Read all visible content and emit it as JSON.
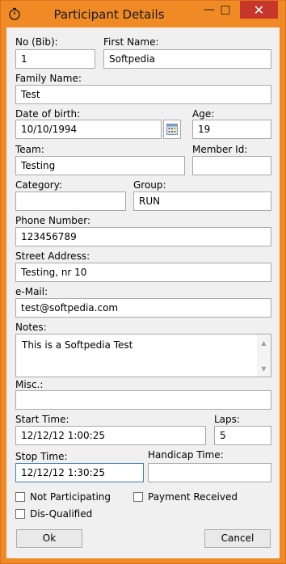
{
  "window": {
    "title": "Participant Details",
    "controls": {
      "minimize": "—",
      "maximize": "□",
      "close": "✕"
    },
    "accent_color": "#f08a24",
    "close_color": "#c7362a",
    "icon": "stopwatch-icon"
  },
  "fields": {
    "bib": {
      "label": "No (Bib):",
      "value": "1"
    },
    "first_name": {
      "label": "First Name:",
      "value": "Softpedia"
    },
    "family_name": {
      "label": "Family Name:",
      "value": "Test"
    },
    "date_of_birth": {
      "label": "Date of birth:",
      "value": "10/10/1994",
      "calendar_icon": "calendar-icon"
    },
    "age": {
      "label": "Age:",
      "value": "19"
    },
    "team": {
      "label": "Team:",
      "value": "Testing"
    },
    "member_id": {
      "label": "Member Id:",
      "value": ""
    },
    "category": {
      "label": "Category:",
      "value": ""
    },
    "group": {
      "label": "Group:",
      "value": "RUN"
    },
    "phone": {
      "label": "Phone Number:",
      "value": "123456789"
    },
    "street": {
      "label": "Street Address:",
      "value": "Testing, nr 10"
    },
    "email": {
      "label": "e-Mail:",
      "value": "test@softpedia.com"
    },
    "notes": {
      "label": "Notes:",
      "value": "This is a Softpedia Test"
    },
    "misc": {
      "label": "Misc.:",
      "value": ""
    },
    "start_time": {
      "label": "Start Time:",
      "value": "12/12/12 1:00:25"
    },
    "laps": {
      "label": "Laps:",
      "value": "5"
    },
    "stop_time": {
      "label": "Stop Time:",
      "value": "12/12/12 1:30:25"
    },
    "handicap_time": {
      "label": "Handicap Time:",
      "value": ""
    }
  },
  "checkboxes": {
    "not_participating": {
      "label": "Not Participating",
      "checked": false
    },
    "payment_received": {
      "label": "Payment Received",
      "checked": false
    },
    "disqualified": {
      "label": "Dis-Qualified",
      "checked": false
    }
  },
  "buttons": {
    "ok": "Ok",
    "cancel": "Cancel"
  }
}
